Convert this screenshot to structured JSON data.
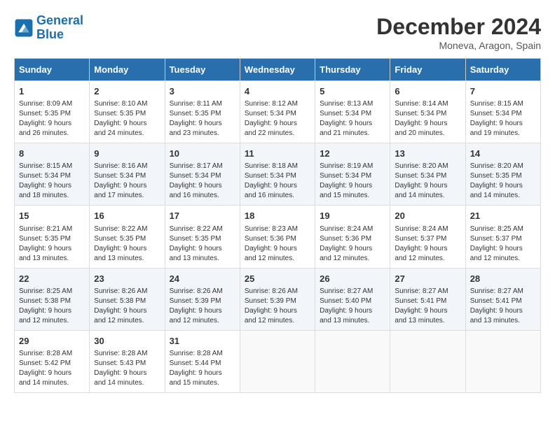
{
  "logo": {
    "line1": "General",
    "line2": "Blue"
  },
  "header": {
    "title": "December 2024",
    "location": "Moneva, Aragon, Spain"
  },
  "days_of_week": [
    "Sunday",
    "Monday",
    "Tuesday",
    "Wednesday",
    "Thursday",
    "Friday",
    "Saturday"
  ],
  "weeks": [
    [
      {
        "day": "1",
        "sunrise": "Sunrise: 8:09 AM",
        "sunset": "Sunset: 5:35 PM",
        "daylight": "Daylight: 9 hours and 26 minutes."
      },
      {
        "day": "2",
        "sunrise": "Sunrise: 8:10 AM",
        "sunset": "Sunset: 5:35 PM",
        "daylight": "Daylight: 9 hours and 24 minutes."
      },
      {
        "day": "3",
        "sunrise": "Sunrise: 8:11 AM",
        "sunset": "Sunset: 5:35 PM",
        "daylight": "Daylight: 9 hours and 23 minutes."
      },
      {
        "day": "4",
        "sunrise": "Sunrise: 8:12 AM",
        "sunset": "Sunset: 5:34 PM",
        "daylight": "Daylight: 9 hours and 22 minutes."
      },
      {
        "day": "5",
        "sunrise": "Sunrise: 8:13 AM",
        "sunset": "Sunset: 5:34 PM",
        "daylight": "Daylight: 9 hours and 21 minutes."
      },
      {
        "day": "6",
        "sunrise": "Sunrise: 8:14 AM",
        "sunset": "Sunset: 5:34 PM",
        "daylight": "Daylight: 9 hours and 20 minutes."
      },
      {
        "day": "7",
        "sunrise": "Sunrise: 8:15 AM",
        "sunset": "Sunset: 5:34 PM",
        "daylight": "Daylight: 9 hours and 19 minutes."
      }
    ],
    [
      {
        "day": "8",
        "sunrise": "Sunrise: 8:15 AM",
        "sunset": "Sunset: 5:34 PM",
        "daylight": "Daylight: 9 hours and 18 minutes."
      },
      {
        "day": "9",
        "sunrise": "Sunrise: 8:16 AM",
        "sunset": "Sunset: 5:34 PM",
        "daylight": "Daylight: 9 hours and 17 minutes."
      },
      {
        "day": "10",
        "sunrise": "Sunrise: 8:17 AM",
        "sunset": "Sunset: 5:34 PM",
        "daylight": "Daylight: 9 hours and 16 minutes."
      },
      {
        "day": "11",
        "sunrise": "Sunrise: 8:18 AM",
        "sunset": "Sunset: 5:34 PM",
        "daylight": "Daylight: 9 hours and 16 minutes."
      },
      {
        "day": "12",
        "sunrise": "Sunrise: 8:19 AM",
        "sunset": "Sunset: 5:34 PM",
        "daylight": "Daylight: 9 hours and 15 minutes."
      },
      {
        "day": "13",
        "sunrise": "Sunrise: 8:20 AM",
        "sunset": "Sunset: 5:34 PM",
        "daylight": "Daylight: 9 hours and 14 minutes."
      },
      {
        "day": "14",
        "sunrise": "Sunrise: 8:20 AM",
        "sunset": "Sunset: 5:35 PM",
        "daylight": "Daylight: 9 hours and 14 minutes."
      }
    ],
    [
      {
        "day": "15",
        "sunrise": "Sunrise: 8:21 AM",
        "sunset": "Sunset: 5:35 PM",
        "daylight": "Daylight: 9 hours and 13 minutes."
      },
      {
        "day": "16",
        "sunrise": "Sunrise: 8:22 AM",
        "sunset": "Sunset: 5:35 PM",
        "daylight": "Daylight: 9 hours and 13 minutes."
      },
      {
        "day": "17",
        "sunrise": "Sunrise: 8:22 AM",
        "sunset": "Sunset: 5:35 PM",
        "daylight": "Daylight: 9 hours and 13 minutes."
      },
      {
        "day": "18",
        "sunrise": "Sunrise: 8:23 AM",
        "sunset": "Sunset: 5:36 PM",
        "daylight": "Daylight: 9 hours and 12 minutes."
      },
      {
        "day": "19",
        "sunrise": "Sunrise: 8:24 AM",
        "sunset": "Sunset: 5:36 PM",
        "daylight": "Daylight: 9 hours and 12 minutes."
      },
      {
        "day": "20",
        "sunrise": "Sunrise: 8:24 AM",
        "sunset": "Sunset: 5:37 PM",
        "daylight": "Daylight: 9 hours and 12 minutes."
      },
      {
        "day": "21",
        "sunrise": "Sunrise: 8:25 AM",
        "sunset": "Sunset: 5:37 PM",
        "daylight": "Daylight: 9 hours and 12 minutes."
      }
    ],
    [
      {
        "day": "22",
        "sunrise": "Sunrise: 8:25 AM",
        "sunset": "Sunset: 5:38 PM",
        "daylight": "Daylight: 9 hours and 12 minutes."
      },
      {
        "day": "23",
        "sunrise": "Sunrise: 8:26 AM",
        "sunset": "Sunset: 5:38 PM",
        "daylight": "Daylight: 9 hours and 12 minutes."
      },
      {
        "day": "24",
        "sunrise": "Sunrise: 8:26 AM",
        "sunset": "Sunset: 5:39 PM",
        "daylight": "Daylight: 9 hours and 12 minutes."
      },
      {
        "day": "25",
        "sunrise": "Sunrise: 8:26 AM",
        "sunset": "Sunset: 5:39 PM",
        "daylight": "Daylight: 9 hours and 12 minutes."
      },
      {
        "day": "26",
        "sunrise": "Sunrise: 8:27 AM",
        "sunset": "Sunset: 5:40 PM",
        "daylight": "Daylight: 9 hours and 13 minutes."
      },
      {
        "day": "27",
        "sunrise": "Sunrise: 8:27 AM",
        "sunset": "Sunset: 5:41 PM",
        "daylight": "Daylight: 9 hours and 13 minutes."
      },
      {
        "day": "28",
        "sunrise": "Sunrise: 8:27 AM",
        "sunset": "Sunset: 5:41 PM",
        "daylight": "Daylight: 9 hours and 13 minutes."
      }
    ],
    [
      {
        "day": "29",
        "sunrise": "Sunrise: 8:28 AM",
        "sunset": "Sunset: 5:42 PM",
        "daylight": "Daylight: 9 hours and 14 minutes."
      },
      {
        "day": "30",
        "sunrise": "Sunrise: 8:28 AM",
        "sunset": "Sunset: 5:43 PM",
        "daylight": "Daylight: 9 hours and 14 minutes."
      },
      {
        "day": "31",
        "sunrise": "Sunrise: 8:28 AM",
        "sunset": "Sunset: 5:44 PM",
        "daylight": "Daylight: 9 hours and 15 minutes."
      },
      null,
      null,
      null,
      null
    ]
  ]
}
